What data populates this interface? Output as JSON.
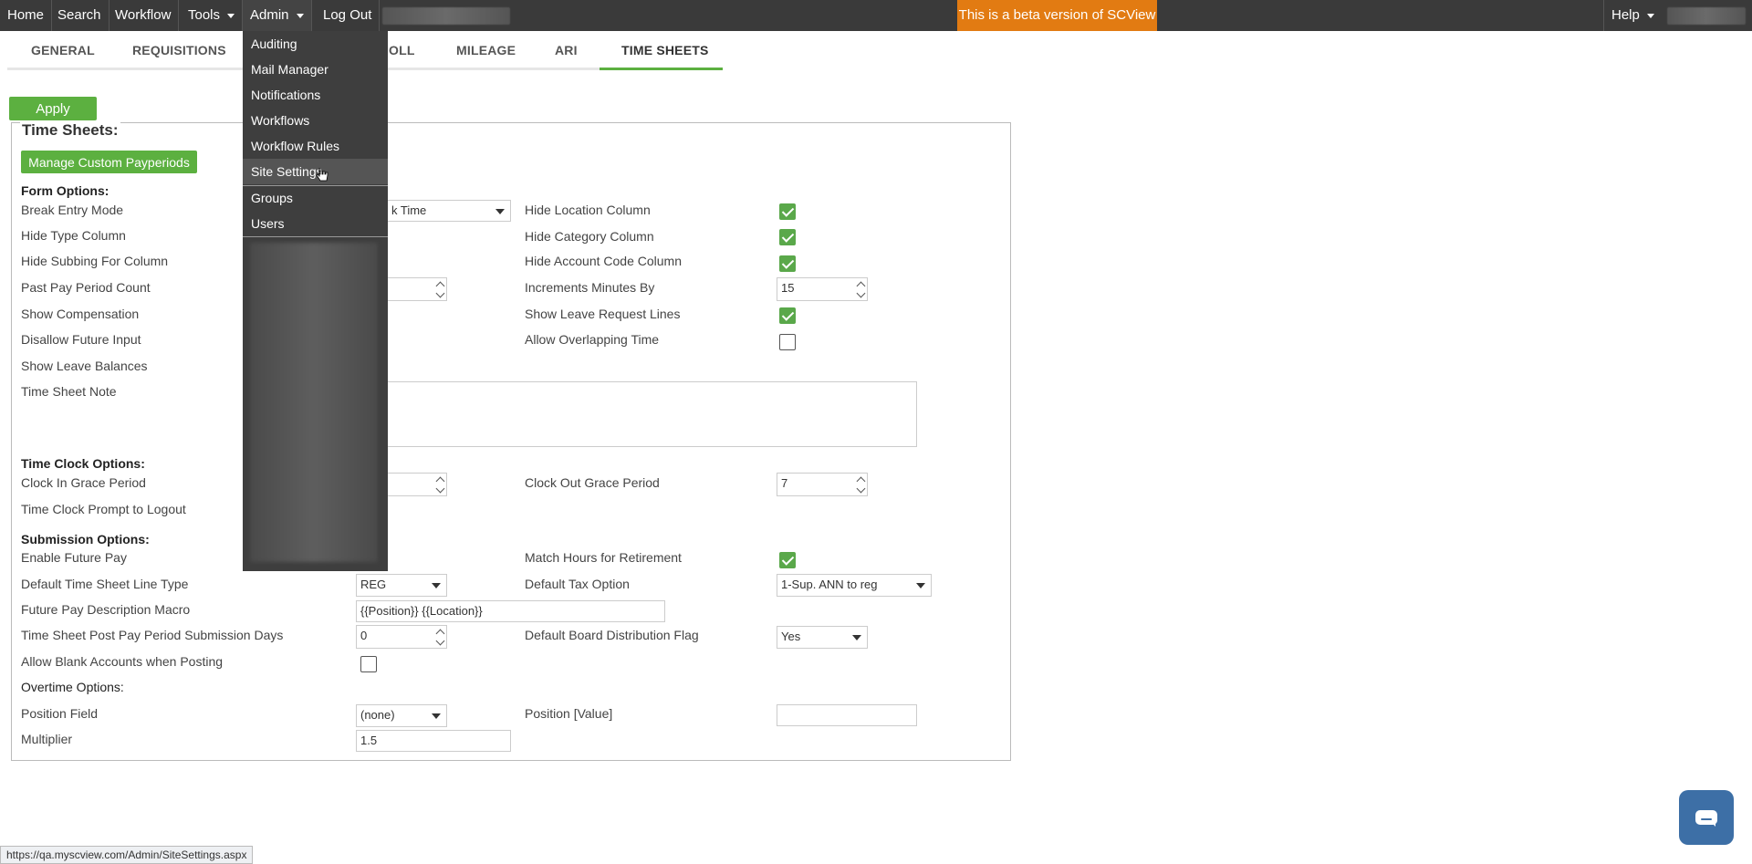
{
  "topbar": {
    "nav": [
      {
        "label": "Home"
      },
      {
        "label": "Search"
      },
      {
        "label": "Workflow"
      },
      {
        "label": "Tools"
      },
      {
        "label": "Admin"
      },
      {
        "label": "Log Out"
      }
    ],
    "beta_text": "This is a beta version of SCView",
    "help_label": "Help",
    "beta_color": "#e27b12"
  },
  "tabs": [
    {
      "label": "GENERAL"
    },
    {
      "label": "REQUISITIONS"
    },
    {
      "label": "OLL"
    },
    {
      "label": "MILEAGE"
    },
    {
      "label": "ARI"
    },
    {
      "label": "TIME SHEETS",
      "active": true
    }
  ],
  "apply_label": "Apply",
  "panel_title": "Time Sheets:",
  "manage_btn": "Manage Custom Payperiods",
  "form_options": {
    "title": "Form Options:",
    "break_entry_mode": {
      "label": "Break Entry Mode",
      "value": "k Time"
    },
    "hide_type_column": "Hide Type Column",
    "hide_subbing": "Hide Subbing For Column",
    "past_pay_period": "Past Pay Period Count",
    "show_compensation": "Show Compensation",
    "disallow_future": "Disallow Future Input",
    "show_leave_balances": "Show Leave Balances",
    "time_sheet_note": "Time Sheet Note",
    "hide_location": {
      "label": "Hide Location Column",
      "checked": true
    },
    "hide_category": {
      "label": "Hide Category Column",
      "checked": true
    },
    "hide_account": {
      "label": "Hide Account Code Column",
      "checked": true
    },
    "increments": {
      "label": "Increments Minutes By",
      "value": "15"
    },
    "show_leave_request": {
      "label": "Show Leave Request Lines",
      "checked": true
    },
    "allow_overlapping": {
      "label": "Allow Overlapping Time",
      "checked": false
    }
  },
  "time_clock": {
    "title": "Time Clock Options:",
    "clock_in_grace": "Clock In Grace Period",
    "prompt_logout": "Time Clock Prompt to Logout",
    "clock_out_grace": {
      "label": "Clock Out Grace Period",
      "value": "7"
    }
  },
  "submission": {
    "title": "Submission Options:",
    "enable_future_pay": "Enable Future Pay",
    "default_line_type": {
      "label": "Default Time Sheet Line Type",
      "value": "REG"
    },
    "future_pay_macro": {
      "label": "Future Pay Description Macro",
      "value": "{{Position}} {{Location}}"
    },
    "post_pay_days": {
      "label": "Time Sheet Post Pay Period Submission Days",
      "value": "0"
    },
    "allow_blank": {
      "label": "Allow Blank Accounts when Posting",
      "checked": false
    },
    "match_hours": {
      "label": "Match Hours for Retirement",
      "checked": true
    },
    "default_tax": {
      "label": "Default Tax Option",
      "value": "1-Sup. ANN to reg"
    },
    "board_dist": {
      "label": "Default Board Distribution Flag",
      "value": "Yes"
    }
  },
  "overtime": {
    "title": "Overtime Options:",
    "position_field": {
      "label": "Position Field",
      "value": "(none)"
    },
    "multiplier": {
      "label": "Multiplier",
      "value": "1.5"
    },
    "position_value": {
      "label": "Position [Value]",
      "value": ""
    }
  },
  "admin_menu": {
    "items": [
      {
        "label": "Auditing"
      },
      {
        "label": "Mail Manager"
      },
      {
        "label": "Notifications"
      },
      {
        "label": "Workflows"
      },
      {
        "label": "Workflow Rules"
      },
      {
        "label": "Site Settings"
      },
      {
        "label": "Groups"
      },
      {
        "label": "Users"
      }
    ]
  },
  "status_url": "https://qa.myscview.com/Admin/SiteSettings.aspx"
}
